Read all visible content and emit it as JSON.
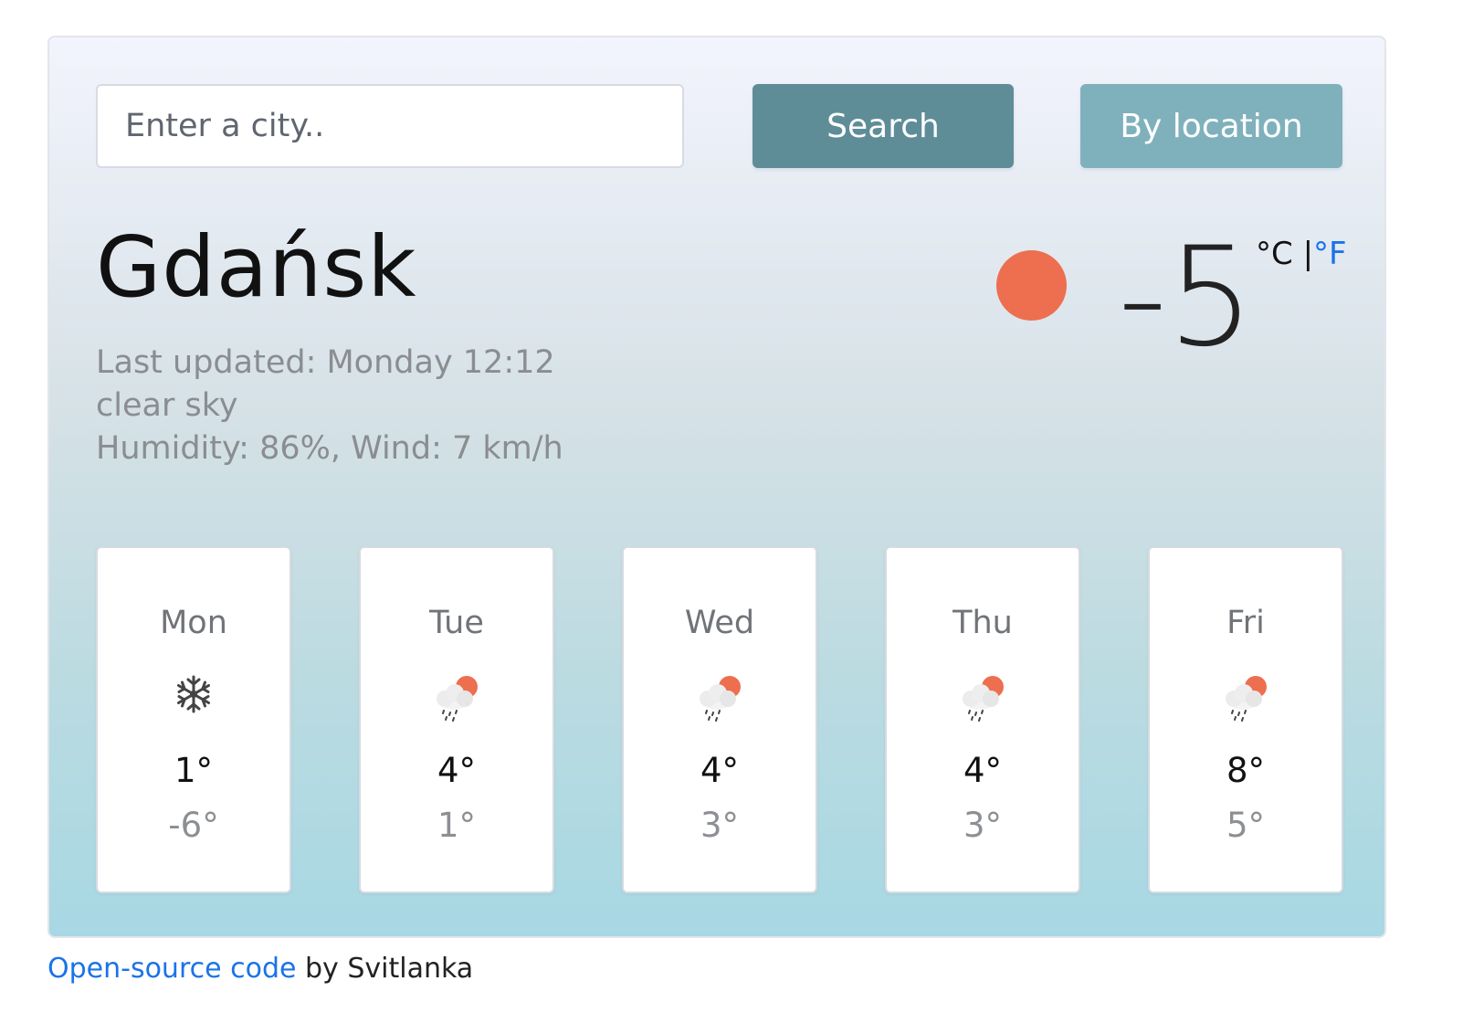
{
  "search": {
    "placeholder": "Enter a city..",
    "value": ""
  },
  "buttons": {
    "search_label": "Search",
    "location_label": "By location"
  },
  "current": {
    "city": "Gdańsk",
    "last_updated": "Last updated: Monday 12:12",
    "description": "clear sky",
    "details": "Humidity: 86%, Wind: 7 km/h",
    "temperature": "-5",
    "unit_celsius": "°C",
    "unit_separator": "|",
    "unit_fahrenheit": "°F",
    "icon": "clear-sky-sun-icon"
  },
  "forecast": [
    {
      "day": "Mon",
      "icon": "snowflake-icon",
      "max": "1°",
      "min": "-6°"
    },
    {
      "day": "Tue",
      "icon": "rain-sun-cloud-icon",
      "max": "4°",
      "min": "1°"
    },
    {
      "day": "Wed",
      "icon": "rain-sun-cloud-icon",
      "max": "4°",
      "min": "3°"
    },
    {
      "day": "Thu",
      "icon": "rain-sun-cloud-icon",
      "max": "4°",
      "min": "3°"
    },
    {
      "day": "Fri",
      "icon": "rain-sun-cloud-icon",
      "max": "8°",
      "min": "5°"
    }
  ],
  "footer": {
    "link_text": "Open-source code",
    "suffix": " by Svitlanka"
  },
  "colors": {
    "search_button": "#5e8d98",
    "location_button": "#7fb1bc",
    "sun": "#ed6f4f",
    "link": "#1a73e8"
  }
}
